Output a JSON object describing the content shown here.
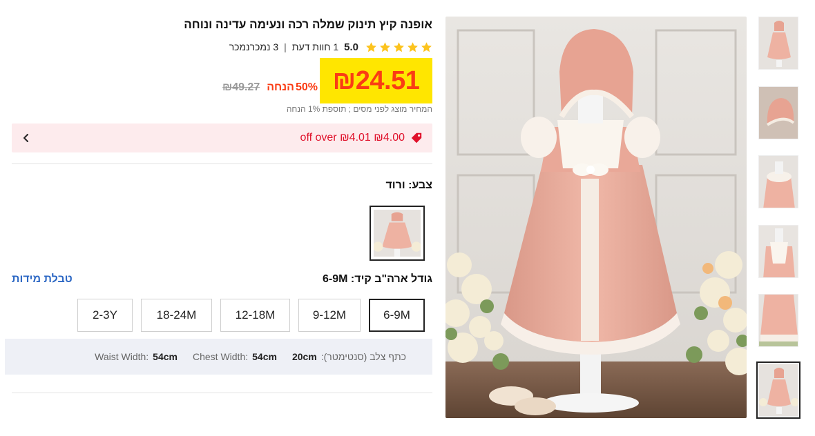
{
  "product": {
    "title": "אופנה קיץ תינוק שמלה רכה ונעימה עדינה ונוחה",
    "rating": {
      "score": "5.0",
      "stars": 5,
      "reviews_count": "1",
      "reviews_label": "חוות דעת",
      "sold_count": "3",
      "sold_label": "נמכרנמכר"
    },
    "price": {
      "current": "₪24.51",
      "discount_pct": "50%",
      "discount_label": "הנחה",
      "original": "₪49.27",
      "tax_note": "המחיר מוצג לפני מסים ; תוספת 1% הנחה"
    },
    "coupon": {
      "text": "₪4.00 ₪4.01 off over"
    },
    "color": {
      "label": "צבע: ורוד"
    },
    "size": {
      "label": "גודל ארה\"ב קיד: 6-9M",
      "chart_link": "טבלת מידות",
      "options": [
        "6-9M",
        "9-12M",
        "12-18M",
        "18-24M",
        "2-3Y"
      ],
      "selected": "6-9M"
    },
    "measurements": [
      {
        "label": "כתף צלב (סנטימטר):",
        "value": "20cm"
      },
      {
        "label": "Chest Width:",
        "value": "54cm"
      },
      {
        "label": "Waist Width:",
        "value": "54cm"
      }
    ]
  },
  "gallery": {
    "thumbnails": [
      "dress-front",
      "bonnet",
      "dress-bodice-back",
      "dress-bodice-front",
      "dress-hem",
      "dress-full"
    ],
    "selected_index": 5
  },
  "colors": {
    "accent": "#fa3c14",
    "price_highlight": "#ffe600",
    "coupon_bg": "#fdebed",
    "coupon_text": "#e0112b",
    "link": "#2d68c4",
    "star": "#fcc31e"
  }
}
